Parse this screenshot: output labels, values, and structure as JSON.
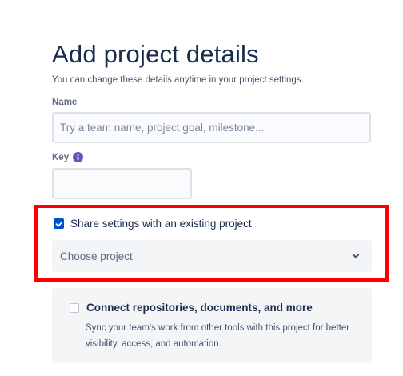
{
  "page": {
    "title": "Add project details",
    "subtitle": "You can change these details anytime in your project settings."
  },
  "name_field": {
    "label": "Name",
    "placeholder": "Try a team name, project goal, milestone...",
    "value": ""
  },
  "key_field": {
    "label": "Key",
    "value": "",
    "info_icon": "info-icon"
  },
  "share_settings": {
    "label": "Share settings with an existing project",
    "checked": true,
    "select_value": "Choose project",
    "highlight_color": "#ff0000"
  },
  "connect": {
    "title": "Connect repositories, documents, and more",
    "description": "Sync your team's work from other tools with this project for better visibility, access, and automation.",
    "checked": false
  },
  "colors": {
    "accent": "#0052cc",
    "info": "#6554c0",
    "text": "#172b4d"
  }
}
